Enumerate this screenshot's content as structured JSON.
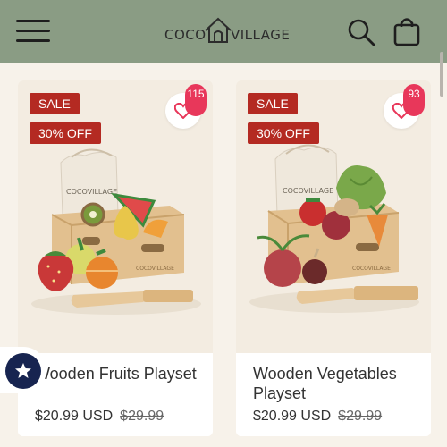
{
  "header": {
    "logo_left": "COCO",
    "logo_right": "VILLAGE",
    "icons": [
      "menu-icon",
      "search-icon",
      "shopping-bag-icon"
    ]
  },
  "colors": {
    "header_bg": "#8a9c84",
    "badge_bg": "#b42a22",
    "wishlist_count_bg": "#e8375a",
    "review_badge_bg": "#172450"
  },
  "products": [
    {
      "sale_label": "SALE",
      "discount_label": "30% OFF",
      "wishlist_count": "115",
      "title": "Wooden Fruits Playset",
      "price": "$20.99 USD",
      "compare_price": "$29.99"
    },
    {
      "sale_label": "SALE",
      "discount_label": "30% OFF",
      "wishlist_count": "93",
      "title": "Wooden Vegetables Playset",
      "price": "$20.99 USD",
      "compare_price": "$29.99"
    }
  ],
  "product_image_text": {
    "bag_logo": "COCOVILLAGE",
    "crate_logo": "COCOVILLAGE"
  },
  "review_widget": {
    "icon": "star-icon"
  }
}
